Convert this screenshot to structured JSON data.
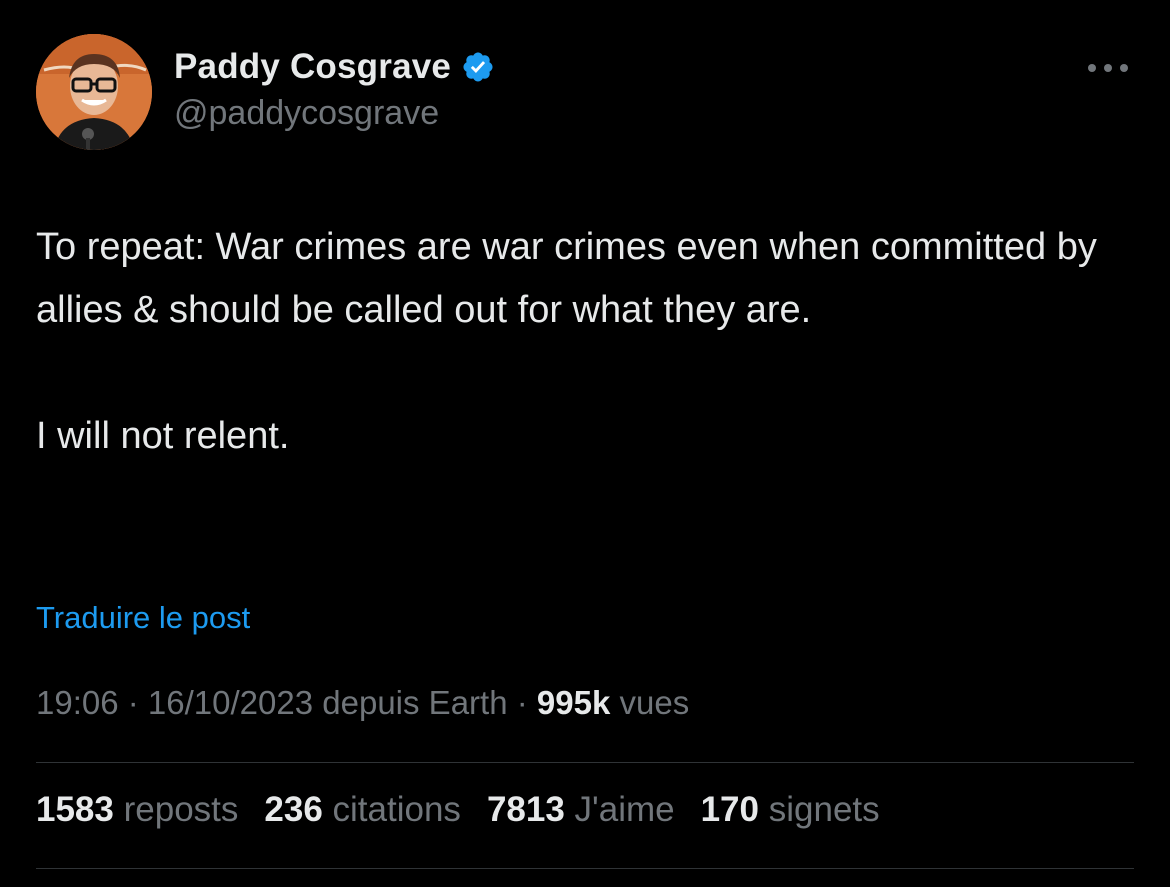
{
  "author": {
    "display_name": "Paddy Cosgrave",
    "handle": "@paddycosgrave",
    "verified_icon": "verified-badge-icon",
    "avatar": "avatar-photo"
  },
  "post": {
    "paragraphs": [
      "To repeat: War crimes are war crimes even when committed by allies & should be called out for what they are.",
      "I will not relent."
    ],
    "translate_label": "Traduire le post"
  },
  "meta": {
    "time": "19:06",
    "separator": " · ",
    "date": "16/10/2023",
    "source": "depuis Earth",
    "views_count": "995k",
    "views_label": "vues"
  },
  "stats": [
    {
      "count": "1583",
      "label": "reposts"
    },
    {
      "count": "236",
      "label": "citations"
    },
    {
      "count": "7813",
      "label": "J'aime"
    },
    {
      "count": "170",
      "label": "signets"
    }
  ],
  "icons": {
    "more": "more-horizontal-icon",
    "verified": "verified-badge-icon"
  },
  "colors": {
    "background": "#000000",
    "text_primary": "#e7e9ea",
    "text_secondary": "#71767b",
    "link": "#1d9bf0",
    "verified": "#1d9bf0",
    "divider": "#2f3336"
  }
}
